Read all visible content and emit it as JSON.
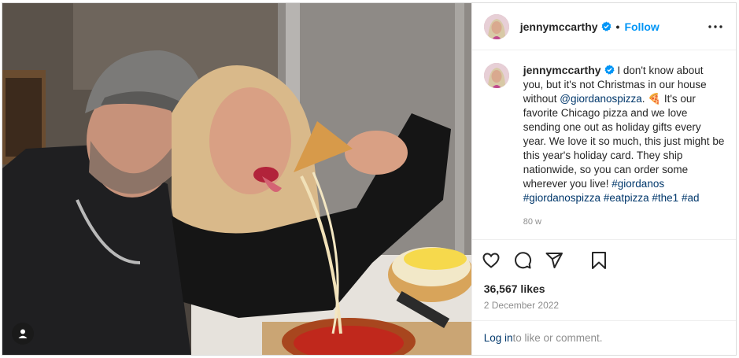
{
  "header": {
    "username": "jennymccarthy",
    "separator": "•",
    "follow_label": "Follow"
  },
  "caption": {
    "username": "jennymccarthy",
    "text_before_mention": "I don't know about you, but it's not Christmas in our house without ",
    "mention": "@giordanospizza",
    "text_after_mention": ". 🍕 It's our favorite Chicago pizza and we love sending one out as holiday gifts every year. We love it so much, this just might be this year's holiday card. They ship nationwide, so you can order some wherever you live! ",
    "hashtags": [
      "#giordanos",
      "#giordanospizza",
      "#eatpizza",
      "#the1",
      "#ad"
    ],
    "time_ago": "80 w"
  },
  "stats": {
    "likes": "36,567 likes",
    "date": "2 December 2022"
  },
  "footer": {
    "login_link": "Log in",
    "login_rest": " to like or comment."
  },
  "icons": {
    "verified_color": "#0095f6",
    "link_color": "#00376b",
    "follow_color": "#0095f6"
  }
}
